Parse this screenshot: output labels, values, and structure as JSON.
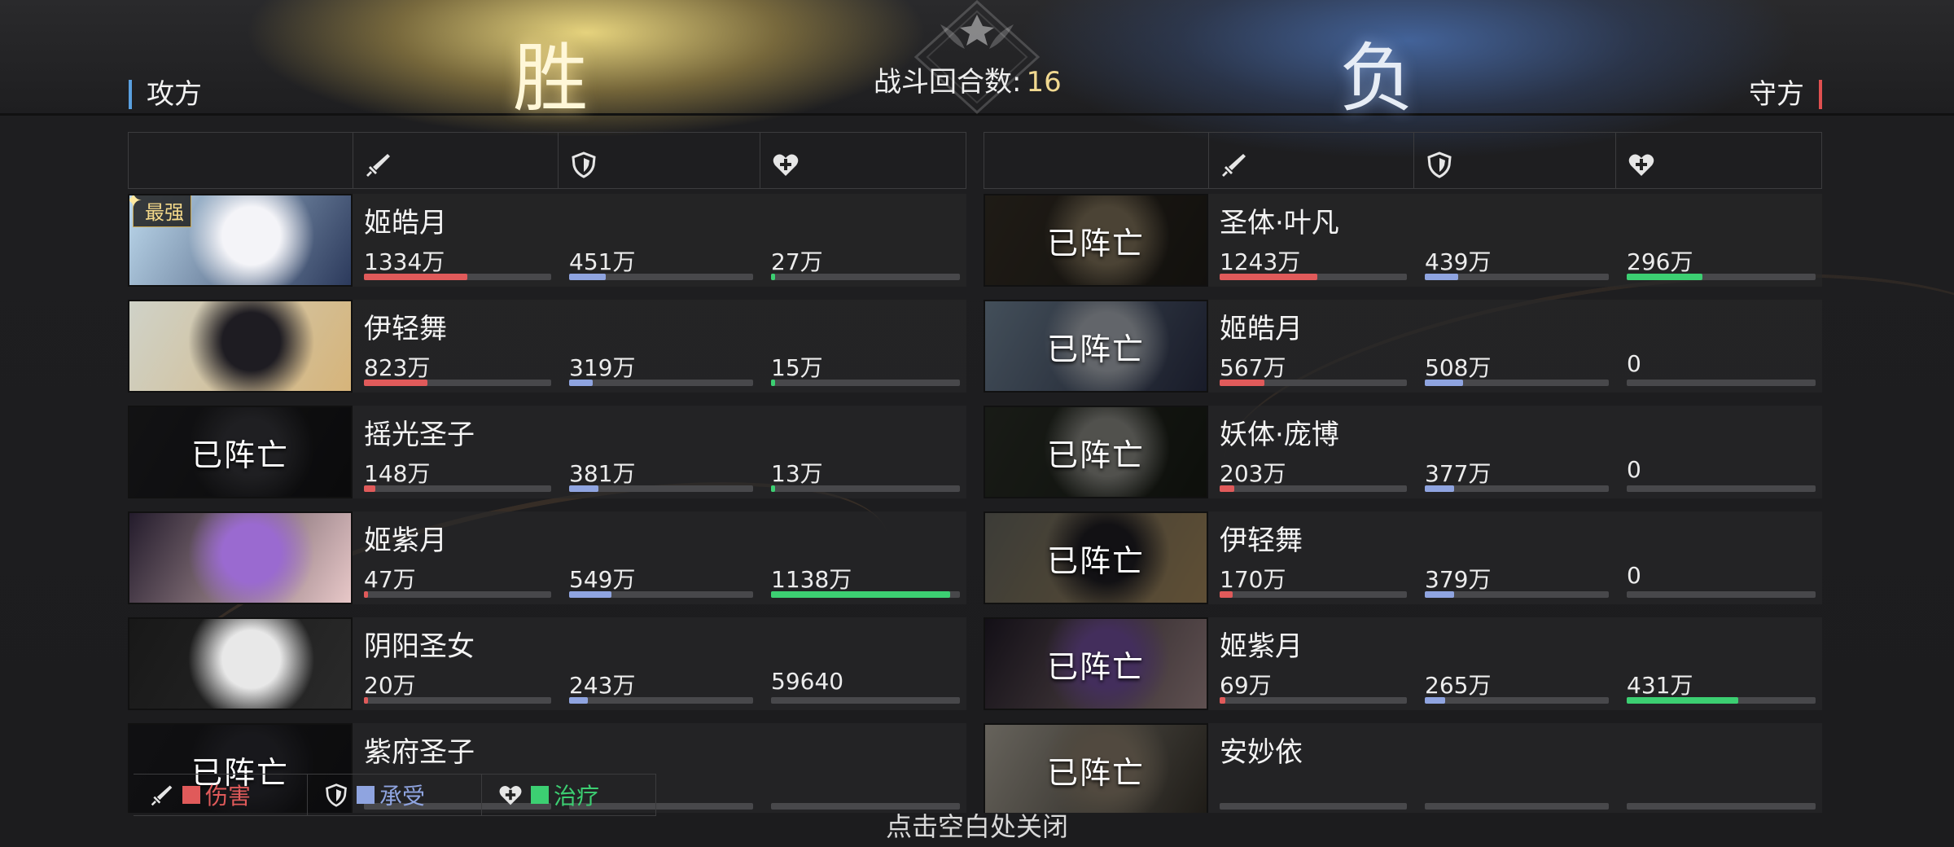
{
  "header": {
    "win_label": "胜",
    "lose_label": "负",
    "round_label": "战斗回合数:",
    "round_value": "16",
    "attacker_label": "攻方",
    "defender_label": "守方"
  },
  "columns": {
    "damage_icon": "sword-icon",
    "taken_icon": "shield-icon",
    "heal_icon": "heart-plus-icon"
  },
  "attacker": [
    {
      "name": "姬皓月",
      "damage": "1334万",
      "taken": "451万",
      "heal": "27万",
      "damage_pct": 0.55,
      "taken_pct": 0.2,
      "heal_pct": 0.02,
      "dead": false,
      "badge": "最强",
      "art": [
        "#bcd8ec",
        "#f4f4f8",
        "#2c3a5c"
      ]
    },
    {
      "name": "伊轻舞",
      "damage": "823万",
      "taken": "319万",
      "heal": "15万",
      "damage_pct": 0.34,
      "taken_pct": 0.13,
      "heal_pct": 0.01,
      "dead": false,
      "art": [
        "#cfd2c8",
        "#1e1c22",
        "#d6b47a"
      ]
    },
    {
      "name": "摇光圣子",
      "damage": "148万",
      "taken": "381万",
      "heal": "13万",
      "damage_pct": 0.06,
      "taken_pct": 0.16,
      "heal_pct": 0.01,
      "dead": true,
      "dead_label": "已阵亡",
      "art": [
        "#1e1e22",
        "#3a3a40",
        "#0e0e10"
      ]
    },
    {
      "name": "姬紫月",
      "damage": "47万",
      "taken": "549万",
      "heal": "1138万",
      "damage_pct": 0.02,
      "taken_pct": 0.23,
      "heal_pct": 0.95,
      "dead": false,
      "art": [
        "#241c2c",
        "#9a6ad0",
        "#e8c8c8"
      ]
    },
    {
      "name": "阴阳圣女",
      "damage": "20万",
      "taken": "243万",
      "heal": "59640",
      "damage_pct": 0.01,
      "taken_pct": 0.1,
      "heal_pct": 0.0,
      "dead": false,
      "art": [
        "#181818",
        "#e8e8e8",
        "#2a2a2a"
      ]
    },
    {
      "name": "紫府圣子",
      "damage": "",
      "taken": "",
      "heal": "",
      "damage_pct": 0,
      "taken_pct": 0,
      "heal_pct": 0,
      "dead": true,
      "dead_label": "已阵亡",
      "art": [
        "#1a1a1e",
        "#2c2c34",
        "#101014"
      ]
    }
  ],
  "defender": [
    {
      "name": "圣体·叶凡",
      "damage": "1243万",
      "taken": "439万",
      "heal": "296万",
      "damage_pct": 0.52,
      "taken_pct": 0.18,
      "heal_pct": 0.4,
      "dead": true,
      "dead_label": "已阵亡",
      "art": [
        "#3a3226",
        "#9c8a6a",
        "#1e1a14"
      ]
    },
    {
      "name": "姬皓月",
      "damage": "567万",
      "taken": "508万",
      "heal": "0",
      "damage_pct": 0.24,
      "taken_pct": 0.21,
      "heal_pct": 0,
      "dead": true,
      "dead_label": "已阵亡",
      "art": [
        "#8aa4bc",
        "#cfd6e0",
        "#2c3250"
      ]
    },
    {
      "name": "妖体·庞博",
      "damage": "203万",
      "taken": "377万",
      "heal": "0",
      "damage_pct": 0.08,
      "taken_pct": 0.16,
      "heal_pct": 0,
      "dead": true,
      "dead_label": "已阵亡",
      "art": [
        "#2c3228",
        "#a8a8a0",
        "#14180f"
      ]
    },
    {
      "name": "伊轻舞",
      "damage": "170万",
      "taken": "379万",
      "heal": "0",
      "damage_pct": 0.07,
      "taken_pct": 0.16,
      "heal_pct": 0,
      "dead": true,
      "dead_label": "已阵亡",
      "art": [
        "#7a7a70",
        "#1e1c22",
        "#c8a46a"
      ]
    },
    {
      "name": "姬紫月",
      "damage": "69万",
      "taken": "265万",
      "heal": "431万",
      "damage_pct": 0.03,
      "taken_pct": 0.11,
      "heal_pct": 0.59,
      "dead": true,
      "dead_label": "已阵亡",
      "art": [
        "#201828",
        "#8a5cc0",
        "#c8a8a8"
      ]
    },
    {
      "name": "安妙依",
      "damage": "",
      "taken": "",
      "heal": "",
      "damage_pct": 0,
      "taken_pct": 0,
      "heal_pct": 0,
      "dead": true,
      "dead_label": "已阵亡",
      "art": [
        "#d8d0c0",
        "#a89880",
        "#3a342a"
      ]
    }
  ],
  "legend": [
    {
      "icon": "sword-icon",
      "label": "伤害",
      "color": "#e05a5a"
    },
    {
      "icon": "shield-icon",
      "label": "承受",
      "color": "#8fa4e0"
    },
    {
      "icon": "heart-plus-icon",
      "label": "治疗",
      "color": "#3ccf72"
    }
  ],
  "close_hint": "点击空白处关闭"
}
